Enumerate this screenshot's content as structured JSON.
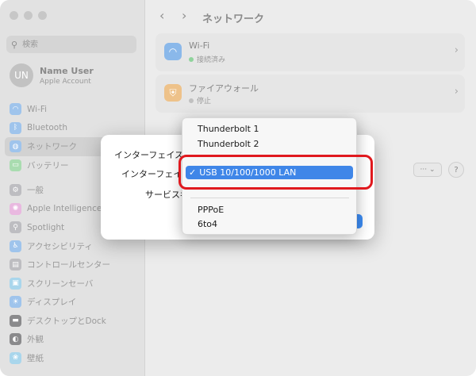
{
  "sidebar": {
    "search_placeholder": "検索",
    "user": {
      "initials": "UN",
      "name": "Name User",
      "subtitle": "Apple Account"
    },
    "items": [
      {
        "label": "Wi-Fi",
        "icon": "wifi-icon",
        "color": "#2b8cf0"
      },
      {
        "label": "Bluetooth",
        "icon": "bluetooth-icon",
        "color": "#2b8cf0"
      },
      {
        "label": "ネットワーク",
        "icon": "globe-icon",
        "color": "#2b8cf0"
      },
      {
        "label": "バッテリー",
        "icon": "battery-icon",
        "color": "#41c658"
      },
      {
        "label": "一般",
        "icon": "gear-icon",
        "color": "#8e8e93"
      },
      {
        "label": "Apple Intelligence",
        "icon": "apple-intelligence-icon",
        "color": "#e46bd0"
      },
      {
        "label": "Spotlight",
        "icon": "spotlight-icon",
        "color": "#8e8e93"
      },
      {
        "label": "アクセシビリティ",
        "icon": "accessibility-icon",
        "color": "#2b8cf0"
      },
      {
        "label": "コントロールセンター",
        "icon": "control-center-icon",
        "color": "#8e8e93"
      },
      {
        "label": "スクリーンセーバ",
        "icon": "screensaver-icon",
        "color": "#46b4e6"
      },
      {
        "label": "ディスプレイ",
        "icon": "display-icon",
        "color": "#2b8cf0"
      },
      {
        "label": "デスクトップとDock",
        "icon": "desktop-dock-icon",
        "color": "#1d1d1f"
      },
      {
        "label": "外観",
        "icon": "appearance-icon",
        "color": "#1d1d1f"
      },
      {
        "label": "壁紙",
        "icon": "wallpaper-icon",
        "color": "#46b4e6"
      }
    ]
  },
  "main": {
    "title": "ネットワーク",
    "services": [
      {
        "name": "Wi-Fi",
        "status": "接続済み",
        "icon": "wifi-icon",
        "color": "#2b8cf0",
        "status_color": "#41c658"
      },
      {
        "name": "ファイアウォール",
        "status": "停止",
        "icon": "firewall-icon",
        "color": "#f0a030",
        "status_color": "#a8a8a8"
      }
    ],
    "more_label": "··· ⌄",
    "help_label": "?"
  },
  "dialog": {
    "label_interface_prefix": "インターフェイスを",
    "label_interface_type": "インターフェイ",
    "label_service_name": "サービス名"
  },
  "menu": {
    "items_top": [
      "Thunderbolt 1",
      "Thunderbolt 2"
    ],
    "selected": "USB 10/100/1000 LAN",
    "items_bottom": [
      "PPPoE",
      "6to4"
    ]
  },
  "colors": {
    "accent": "#3f86e8",
    "highlight": "#e0191e"
  }
}
